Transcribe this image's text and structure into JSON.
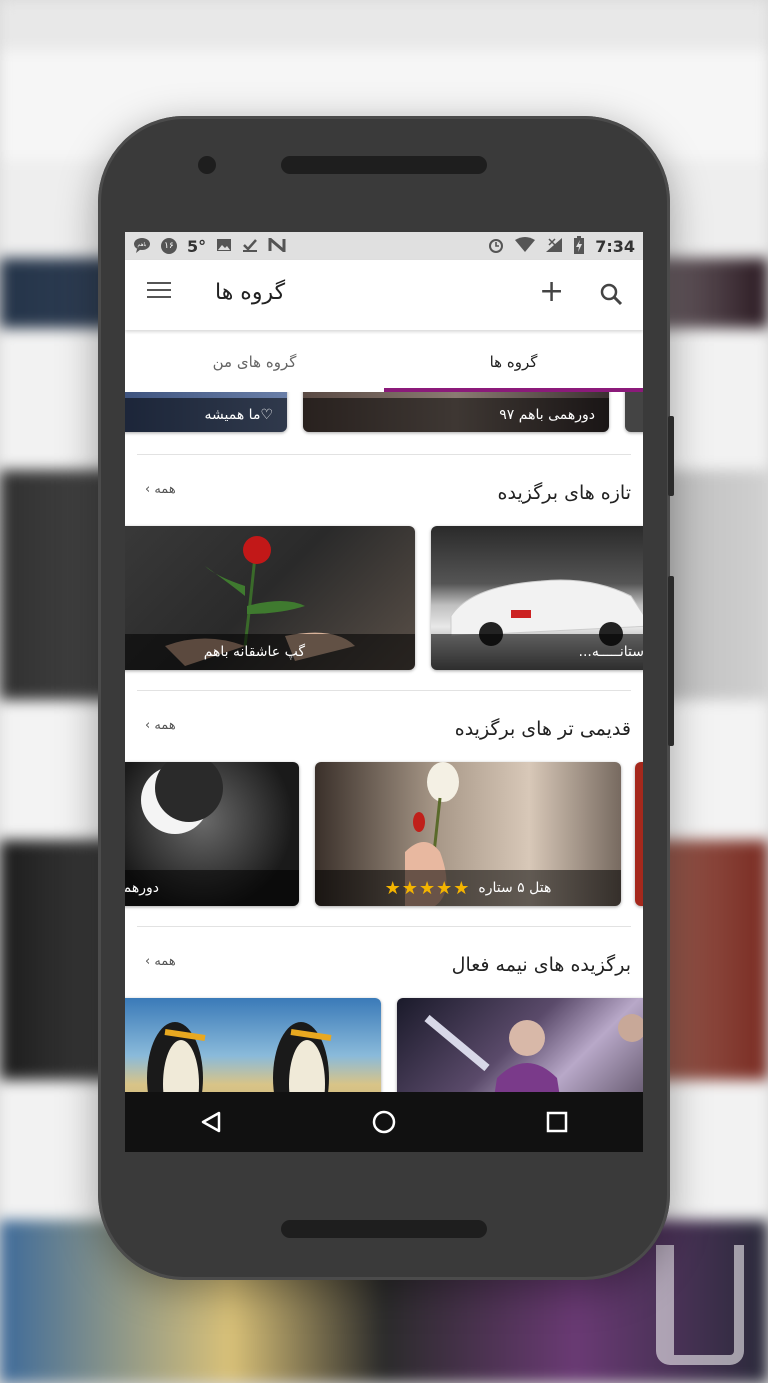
{
  "status_bar": {
    "temperature": "5°",
    "badge": "۱۶",
    "badge2": "باهم",
    "time": "7:34"
  },
  "toolbar": {
    "title": "گروه ها",
    "menu_icon": "menu-icon",
    "add_icon": "plus-icon",
    "search_icon": "search-icon"
  },
  "tabs": {
    "groups": "گروه ها",
    "my_groups": "گروه های من",
    "active_tab": "groups",
    "indicator_color": "#8b1a7a"
  },
  "top_row": {
    "items": [
      {
        "caption": "دورهمی باهم ۹۷"
      },
      {
        "caption": "♡ما همیشه"
      }
    ]
  },
  "sections": [
    {
      "title": "تازه های برگزیده",
      "more": "همه ›",
      "items": [
        {
          "caption": "دوستانـــــه..."
        },
        {
          "caption": "گپ عاشقانه باهم"
        }
      ]
    },
    {
      "title": "قدیمی تر های برگزیده",
      "more": "همه ›",
      "items": [
        {
          "caption": "هتل ۵ ستاره",
          "stars": "★★★★★"
        },
        {
          "caption": "دورهمی"
        }
      ]
    },
    {
      "title": "برگزیده های نیمه فعال",
      "more": "همه ›",
      "items": [
        {
          "caption": ""
        },
        {
          "caption": ""
        }
      ]
    }
  ],
  "nav": {
    "back": "back-icon",
    "home": "home-icon",
    "recents": "recents-icon"
  },
  "colors": {
    "accent": "#8b1a7a",
    "star": "#f4b400",
    "phone_body": "#3a3a3a"
  }
}
